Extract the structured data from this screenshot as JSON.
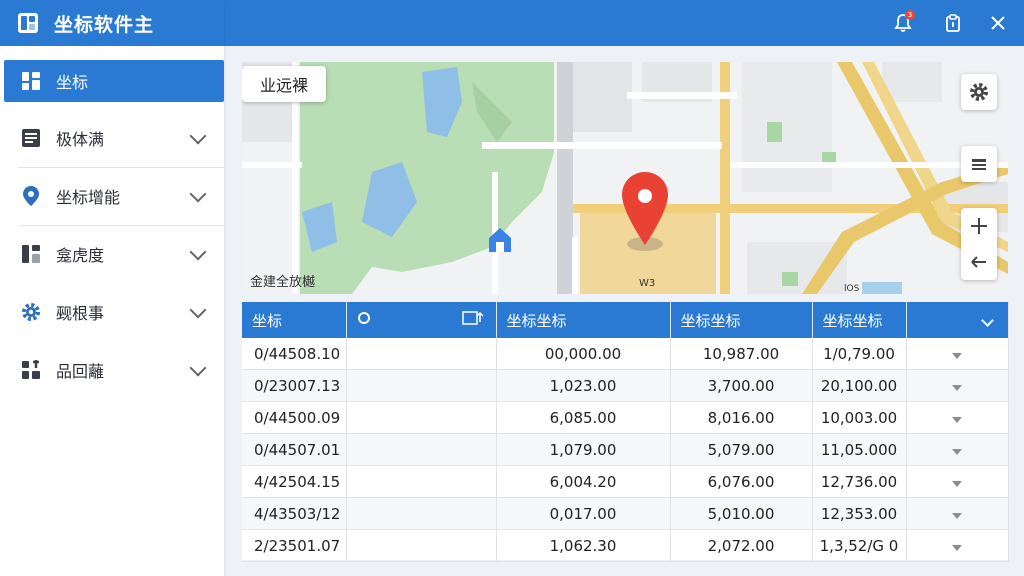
{
  "app": {
    "title": "坐标软件主"
  },
  "sidebar": {
    "items": [
      {
        "label": "坐标",
        "icon": "grid-icon",
        "active": true
      },
      {
        "label": "极体满",
        "icon": "document-icon"
      },
      {
        "label": "坐标增能",
        "icon": "map-pin-icon"
      },
      {
        "label": "龛虎度",
        "icon": "bar-layout-icon"
      },
      {
        "label": "觋根事",
        "icon": "gear-icon"
      },
      {
        "label": "品回蘺",
        "icon": "apps-icon"
      }
    ]
  },
  "topbar": {
    "notification_badge": "3"
  },
  "map": {
    "search_chip": "业远裸",
    "caption": "金建全放樾",
    "marker_label": "W3",
    "corner_label": "lOS",
    "accent_marker_color": "#e94235",
    "building_icon_color": "#3b82e6"
  },
  "table": {
    "headers": [
      "坐标",
      "",
      "",
      "坐标坐标",
      "坐标坐标",
      "坐标坐标",
      ""
    ],
    "rows": [
      [
        "0/44508.10",
        "",
        "00,000.00",
        "10,987.00",
        "1/0,79.00"
      ],
      [
        "0/23007.13",
        "",
        "1,023.00",
        "3,700.00",
        "20,100.00"
      ],
      [
        "0/44500.09",
        "",
        "6,085.00",
        "8,016.00",
        "10,003.00"
      ],
      [
        "0/44507.01",
        "",
        "1,079.00",
        "5,079.00",
        "11,05.000"
      ],
      [
        "4/42504.15",
        "",
        "6,004.20",
        "6,076.00",
        "12,736.00"
      ],
      [
        "4/43503/12",
        "",
        "0,017.00",
        "5,010.00",
        "12,353.00"
      ],
      [
        "2/23501.07",
        "",
        "1,062.30",
        "2,072.00",
        "1,3,52/G 0"
      ]
    ]
  }
}
